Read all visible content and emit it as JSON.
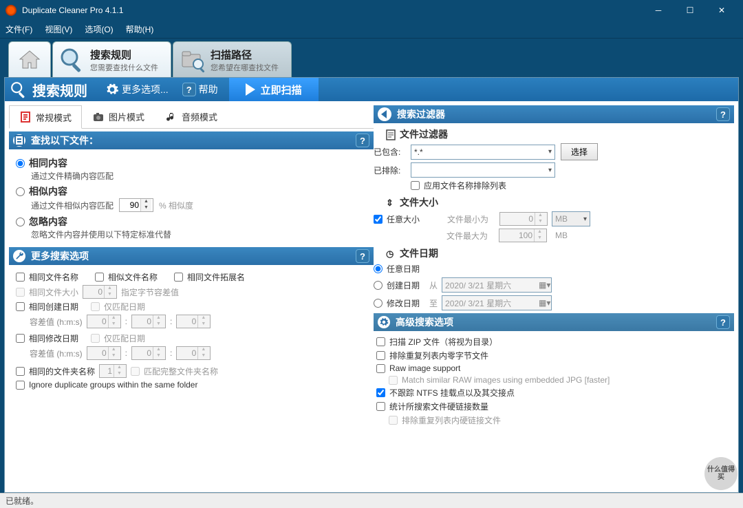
{
  "title": "Duplicate Cleaner Pro 4.1.1",
  "menu": {
    "file": "文件(F)",
    "view": "视图(V)",
    "options": "选项(O)",
    "help": "帮助(H)"
  },
  "tabs": {
    "home": "",
    "rules": {
      "title": "搜索规则",
      "sub": "您需要查找什么文件"
    },
    "paths": {
      "title": "扫描路径",
      "sub": "您希望在哪查找文件"
    }
  },
  "toolbar": {
    "title": "搜索规则",
    "more": "更多选项...",
    "help": "帮助",
    "scan": "立即扫描"
  },
  "modeTabs": {
    "normal": "常规模式",
    "image": "图片模式",
    "audio": "音频模式"
  },
  "findSection": {
    "header": "查找以下文件："
  },
  "radios": {
    "same": {
      "label": "相同内容",
      "desc": "通过文件精确内容匹配"
    },
    "similar": {
      "label": "相似内容",
      "desc": "通过文件相似内容匹配",
      "pct": "90",
      "pctLabel": "% 相似度"
    },
    "ignore": {
      "label": "忽略内容",
      "desc": "忽略文件内容并使用以下特定标准代替"
    }
  },
  "moreOpts": {
    "header": "更多搜索选项",
    "sameName": "相同文件名称",
    "similarName": "相似文件名称",
    "sameExt": "相同文件拓展名",
    "sameSize": "相同文件大小",
    "sizeVal": "0",
    "sizeHint": "指定字节容差值",
    "sameCreated": "相同创建日期",
    "onlyDate1": "仅匹配日期",
    "tolLabel": "容差值 (h:m:s)",
    "h": "0",
    "m": "0",
    "s": "0",
    "sameModified": "相同修改日期",
    "onlyDate2": "仅匹配日期",
    "sameFolder": "相同的文件夹名称",
    "folderVal": "1",
    "matchFull": "匹配完整文件夹名称",
    "ignoreGroups": "Ignore duplicate groups within the same folder"
  },
  "filters": {
    "header": "搜索过滤器",
    "fileFilter": "文件过滤器",
    "included": "已包含:",
    "includedVal": "*.*",
    "excluded": "已排除:",
    "select": "选择",
    "applyExclude": "应用文件名称排除列表",
    "sizeHeader": "文件大小",
    "anySize": "任意大小",
    "minLabel": "文件最小为",
    "minVal": "0",
    "minUnit": "MB",
    "maxLabel": "文件最大为",
    "maxVal": "100",
    "maxUnit": "MB",
    "dateHeader": "文件日期",
    "anyDate": "任意日期",
    "created": "创建日期",
    "modified": "修改日期",
    "from": "从",
    "to": "至",
    "dateVal": "2020/ 3/21 星期六"
  },
  "adv": {
    "header": "高级搜索选项",
    "zip": "扫描 ZIP 文件（将视为目录）",
    "zero": "排除重复列表内零字节文件",
    "raw": "Raw image support",
    "rawMatch": "Match similar RAW images using embedded JPG [faster]",
    "ntfs": "不跟踪 NTFS 挂载点以及其交接点",
    "hardCount": "统计所搜索文件硬链接数量",
    "hardExcl": "排除重复列表内硬链接文件"
  },
  "status": "已就绪。",
  "watermark": "什么值得买"
}
